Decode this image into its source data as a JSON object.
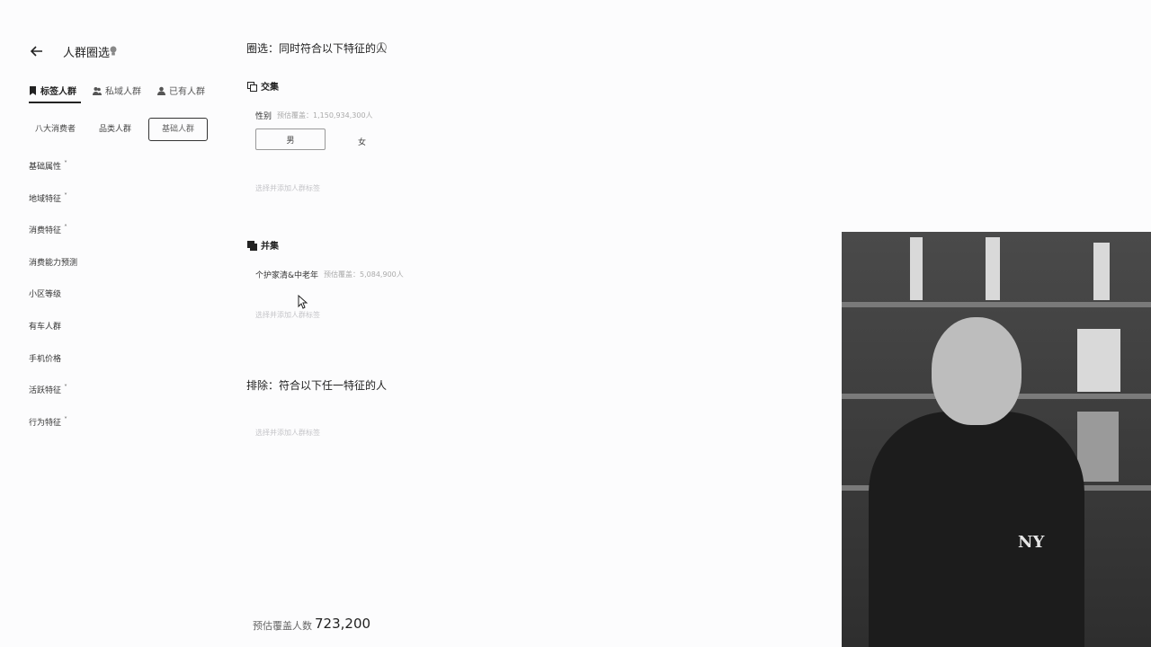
{
  "sidebar": {
    "title": "人群圈选",
    "tabs": [
      {
        "label": "标签人群",
        "icon": "bookmark-icon",
        "active": true
      },
      {
        "label": "私域人群",
        "icon": "group-icon",
        "active": false
      },
      {
        "label": "已有人群",
        "icon": "user-icon",
        "active": false
      }
    ],
    "sub_tabs": [
      {
        "label": "八大消费者",
        "selected": false
      },
      {
        "label": "品类人群",
        "selected": false
      },
      {
        "label": "基础人群",
        "selected": true
      }
    ],
    "categories": [
      {
        "label": "基础属性",
        "chevron": "˅"
      },
      {
        "label": "地域特征",
        "chevron": "˅"
      },
      {
        "label": "消费特征",
        "chevron": "˄"
      },
      {
        "label": "消费能力预测",
        "chevron": ""
      },
      {
        "label": "小区等级",
        "chevron": ""
      },
      {
        "label": "有车人群",
        "chevron": ""
      },
      {
        "label": "手机价格",
        "chevron": ""
      },
      {
        "label": "活跃特征",
        "chevron": "˅"
      },
      {
        "label": "行为特征",
        "chevron": "˅"
      }
    ]
  },
  "main": {
    "title": "圈选：同时符合以下特征的人",
    "info_glyph": "i",
    "intersection": {
      "title": "交集",
      "field_label": "性别",
      "estimate": "预估覆盖：1,150,934,300人",
      "options": [
        "男",
        "女"
      ],
      "placeholder": "选择并添加人群标签"
    },
    "union": {
      "title": "并集",
      "field_label": "个护家清&中老年",
      "estimate": "预估覆盖：5,084,900人",
      "placeholder": "选择并添加人群标签"
    },
    "exclude": {
      "title": "排除：符合以下任一特征的人",
      "placeholder": "选择并添加人群标签"
    },
    "coverage": {
      "label": "预估覆盖人数",
      "value": "723,200"
    }
  },
  "webcam": {
    "shirt_logo": "NY"
  }
}
